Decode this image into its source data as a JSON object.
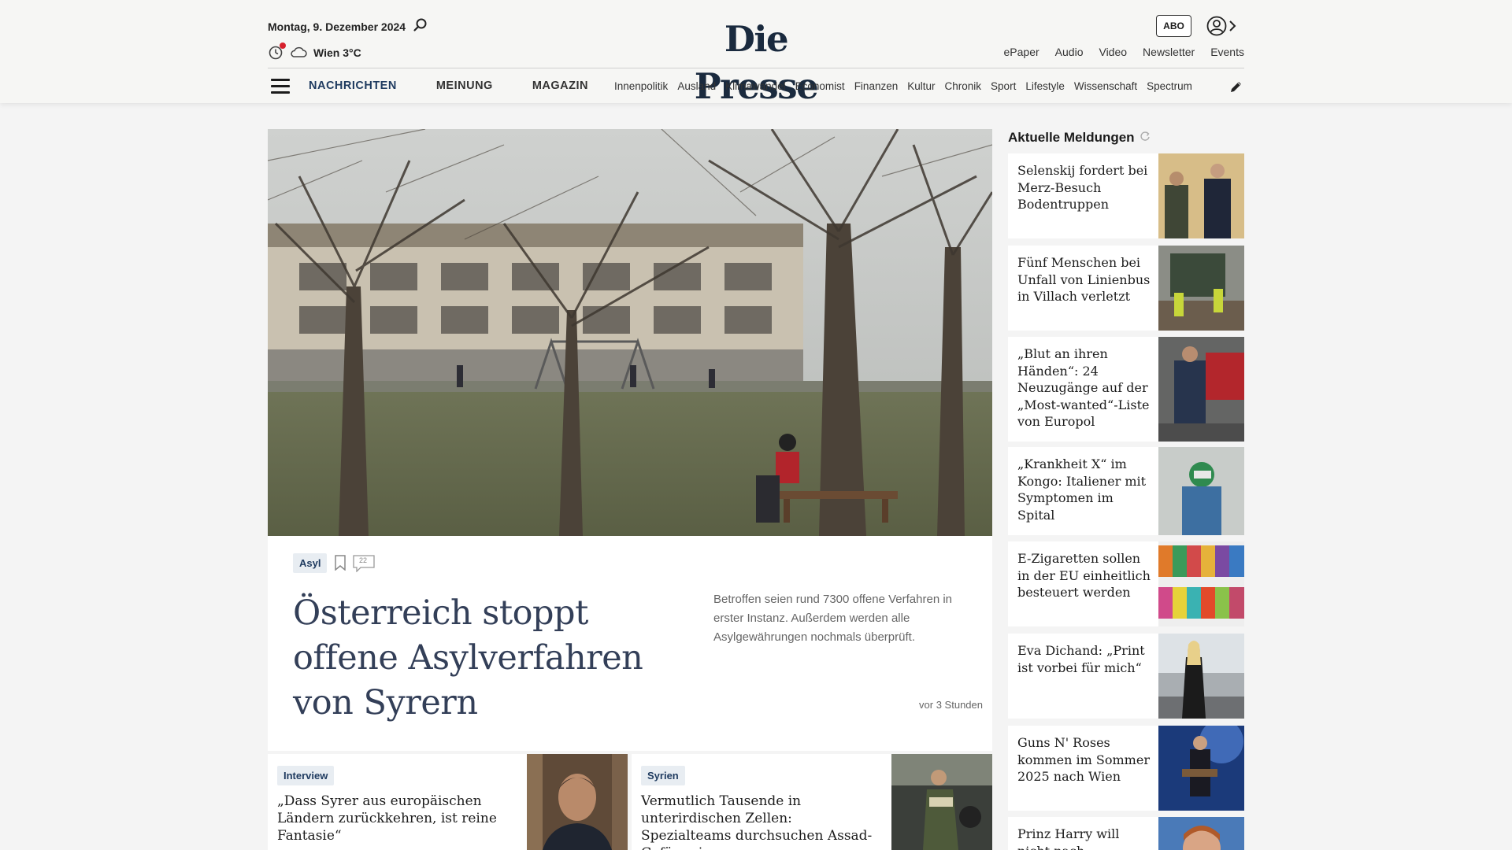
{
  "header": {
    "date": "Montag, 9. Dezember 2024",
    "weather": "Wien 3°C",
    "logo": "Die Presse",
    "abo": "ABO",
    "topnav": [
      "ePaper",
      "Audio",
      "Video",
      "Newsletter",
      "Events"
    ],
    "mainnav": [
      "NACHRICHTEN",
      "MEINUNG",
      "MAGAZIN"
    ],
    "subnav": [
      "Innenpolitik",
      "Ausland",
      "Klimawandel",
      "Economist",
      "Finanzen",
      "Kultur",
      "Chronik",
      "Sport",
      "Lifestyle",
      "Wissenschaft",
      "Spectrum"
    ]
  },
  "hero": {
    "tag": "Asyl",
    "comment_count": "22",
    "title": "Österreich stoppt offene Asylverfahren von Syrern",
    "teaser": "Betroffen seien rund 7300 offene Verfahren in erster Instanz. Außerdem werden alle Asylgewährungen nochmals überprüft.",
    "time": "vor 3 Stunden"
  },
  "cards": [
    {
      "tag": "Interview",
      "title": "„Dass Syrer aus europäischen Ländern zurückkehren, ist reine Fantasie“"
    },
    {
      "tag": "Syrien",
      "title": "Vermutlich Tausende in unterirdischen Zellen: Spezialteams durchsuchen Assad-Gefängnis"
    }
  ],
  "sidebar": {
    "title": "Aktuelle Meldungen",
    "items": [
      {
        "title": "Selenskij fordert bei Merz-Besuch Bodentruppen"
      },
      {
        "title": "Fünf Menschen bei Unfall von Linienbus in Villach verletzt"
      },
      {
        "title": "„Blut an ihren Händen“: 24 Neuzugänge auf der „Most-wanted“-Liste von Europol"
      },
      {
        "title": "„Krankheit X“ im Kongo: Italiener mit Symptomen im Spital"
      },
      {
        "title": "E-Zigaretten sollen in der EU einheitlich besteuert werden"
      },
      {
        "title": "Eva Dichand: „Print ist vorbei für mich“"
      },
      {
        "title": "Guns N' Roses kommen im Sommer 2025 nach Wien"
      },
      {
        "title": "Prinz Harry will nicht nach"
      }
    ]
  },
  "colors": {
    "brand": "#1a2a3e",
    "accent": "#1e3a5f",
    "alert": "#d6202c"
  }
}
